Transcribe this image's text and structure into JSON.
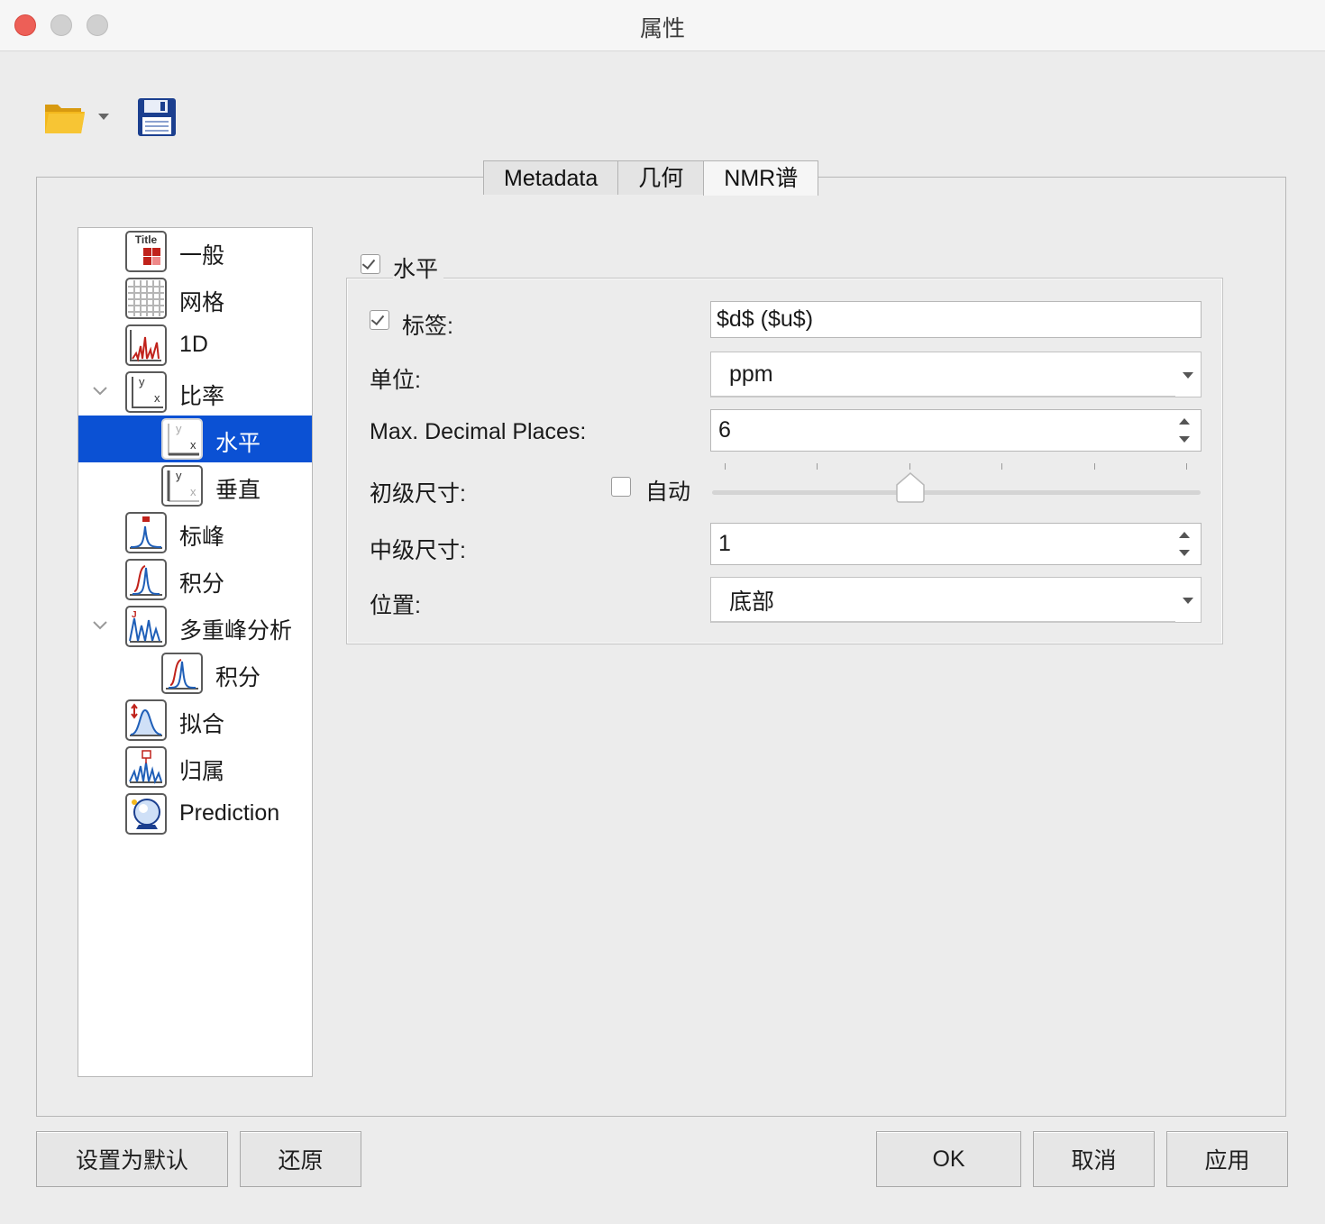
{
  "window": {
    "title": "属性"
  },
  "toolbar": {
    "open_icon": "folder-open-icon",
    "save_icon": "floppy-disk-icon"
  },
  "tabs": [
    {
      "label": "Metadata"
    },
    {
      "label": "几何"
    },
    {
      "label": "NMR谱",
      "active": true
    }
  ],
  "tree": {
    "items": [
      {
        "label": "一般",
        "icon": "title-icon"
      },
      {
        "label": "网格",
        "icon": "grid-icon"
      },
      {
        "label": "1D",
        "icon": "spectrum-1d-icon"
      },
      {
        "label": "比率",
        "icon": "axes-icon",
        "expanded": true
      },
      {
        "label": "水平",
        "icon": "horizontal-axis-icon",
        "selected": true
      },
      {
        "label": "垂直",
        "icon": "vertical-axis-icon"
      },
      {
        "label": "标峰",
        "icon": "peak-label-icon"
      },
      {
        "label": "积分",
        "icon": "integral-icon"
      },
      {
        "label": "多重峰分析",
        "icon": "multiplet-icon",
        "expanded": true
      },
      {
        "label": "积分",
        "icon": "integral-icon"
      },
      {
        "label": "拟合",
        "icon": "fitting-icon"
      },
      {
        "label": "归属",
        "icon": "assignment-icon"
      },
      {
        "label": "Prediction",
        "icon": "prediction-icon"
      }
    ]
  },
  "panel": {
    "group_title": "水平",
    "group_checked": true,
    "label_checkbox": "标签:",
    "label_checked": true,
    "label_value": "$d$ ($u$)",
    "units_label": "单位:",
    "units_value": "ppm",
    "decimal_label": "Max. Decimal Places:",
    "decimal_value": "6",
    "primary_label": "初级尺寸:",
    "auto_label": "自动",
    "auto_checked": false,
    "slider_level": 0.4,
    "secondary_label": "中级尺寸:",
    "secondary_value": "1",
    "position_label": "位置:",
    "position_value": "底部"
  },
  "buttons": {
    "set_default": "设置为默认",
    "restore": "还原",
    "ok": "OK",
    "cancel": "取消",
    "apply": "应用"
  },
  "colors": {
    "selection": "#0b51d4",
    "close": "#ed5f57",
    "icon_blue": "#1f5fb8",
    "icon_red": "#c0221b"
  }
}
